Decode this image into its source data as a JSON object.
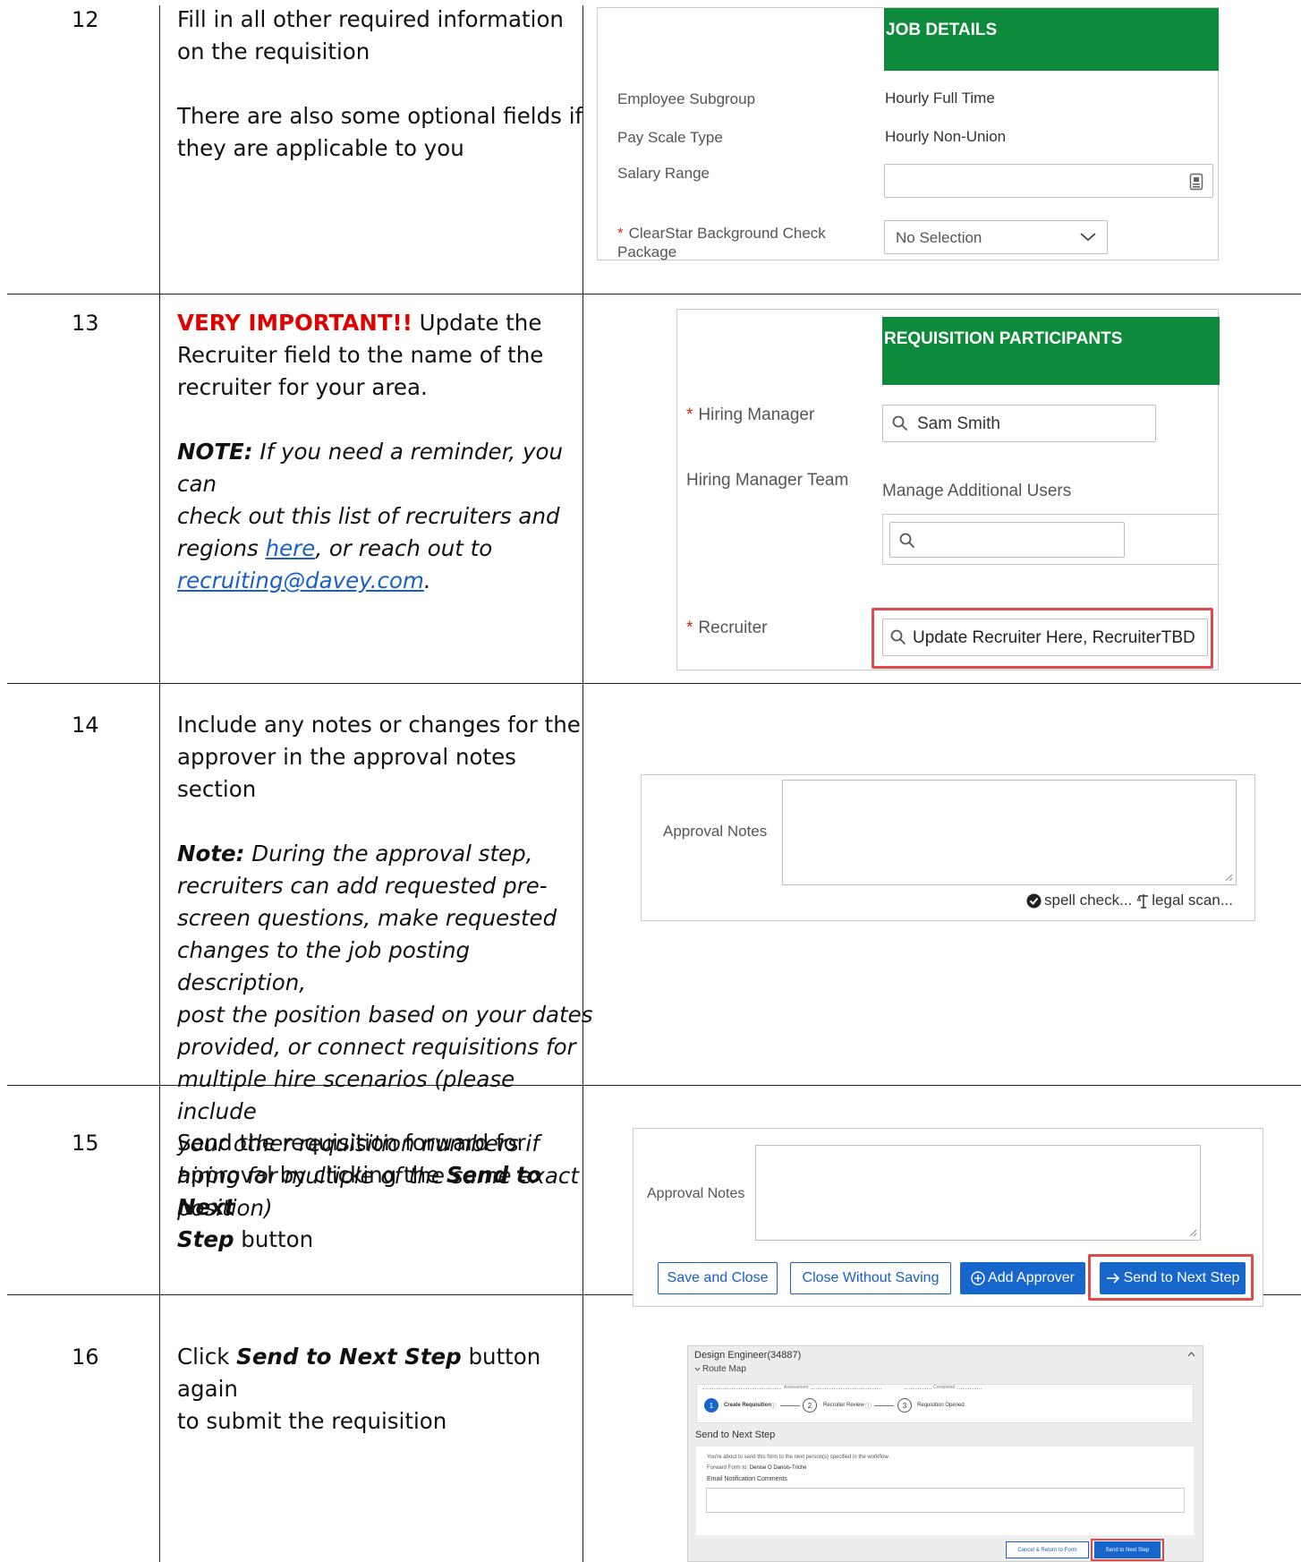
{
  "rows": [
    {
      "number": "12",
      "lines": [
        "Fill in all other required information",
        "on the requisition"
      ],
      "lines2": [
        "There are also some optional fields if",
        "they are applicable to you"
      ]
    },
    {
      "number": "13",
      "important": "VERY IMPORTANT!!",
      "lead": " Update the",
      "lines": [
        "Recruiter field to the name of the",
        "recruiter for your area."
      ],
      "note_label": "NOTE:",
      "note_lines": [
        " If you need a reminder, you can",
        "check out this list of recruiters and"
      ],
      "note_regions": "regions ",
      "note_link": "here",
      "note_after": ", or reach out to",
      "note_email": "recruiting@davey.com",
      "note_period": "."
    },
    {
      "number": "14",
      "lines": [
        "Include any notes or changes for the",
        "approver in the approval notes section"
      ],
      "note_label": "Note:",
      "note_lines": [
        " During the approval step,",
        "recruiters can add requested pre-",
        "screen questions, make requested",
        "changes to the job posting description,",
        "post the position based on your dates",
        "provided, or connect requisitions for",
        "multiple hire scenarios (please include",
        "your other requisition numbers if",
        "hiring for multiple of the same exact",
        "position)"
      ]
    },
    {
      "number": "15",
      "l1": "Send the requisition forward for",
      "l2a": "approval by clicking the ",
      "l2b": "Send to Next",
      "l3a": "Step",
      "l3b": " button"
    },
    {
      "number": "16",
      "l1a": "Click ",
      "l1b": "Send to Next Step",
      "l1c": " button again",
      "l2": "to submit the requisition"
    }
  ],
  "job_details": {
    "header": "JOB DETAILS",
    "fields": [
      {
        "label": "Employee Subgroup",
        "value": "Hourly Full Time"
      },
      {
        "label": "Pay Scale Type",
        "value": "Hourly Non-Union"
      },
      {
        "label": "Salary Range",
        "value": ""
      }
    ],
    "bg_label_1": "ClearStar Background Check",
    "bg_label_2": "Package",
    "bg_value": "No Selection",
    "required_mark": "*"
  },
  "participants": {
    "header": "REQUISITION PARTICIPANTS",
    "hiring_manager_label": "Hiring Manager",
    "hiring_manager_value": "Sam Smith",
    "team_label": "Hiring Manager Team",
    "manage_users": "Manage Additional Users",
    "recruiter_label": "Recruiter",
    "recruiter_value": "Update Recruiter Here, RecruiterTBD",
    "required_mark": "*"
  },
  "approval1": {
    "label": "Approval Notes",
    "spell_check": "spell check...",
    "legal_scan": "legal scan..."
  },
  "approval2": {
    "label": "Approval Notes",
    "save_close": "Save and Close",
    "close_no_save": "Close Without Saving",
    "add_approver": "Add Approver",
    "send_next": "Send to Next Step"
  },
  "route": {
    "title": "Design Engineer(34887)",
    "route_map": "Route Map",
    "phase_assessment": "Assessment",
    "phase_completed": "Completed",
    "steps": [
      {
        "num": "1",
        "label": "Create Requisition"
      },
      {
        "num": "2",
        "label": "Recruiter Review"
      },
      {
        "num": "3",
        "label": "Requisition Opened"
      }
    ],
    "section": "Send to Next Step",
    "about": "You're about to send this form to the next person(s) specified in the workflow.",
    "forward_label": "Forward Form to:",
    "forward_value": "Denise O Danois-Triche",
    "email_comments": "Email Notification Comments",
    "cancel_btn": "Cancel & Return to Form",
    "send_btn": "Send to Next Step"
  }
}
